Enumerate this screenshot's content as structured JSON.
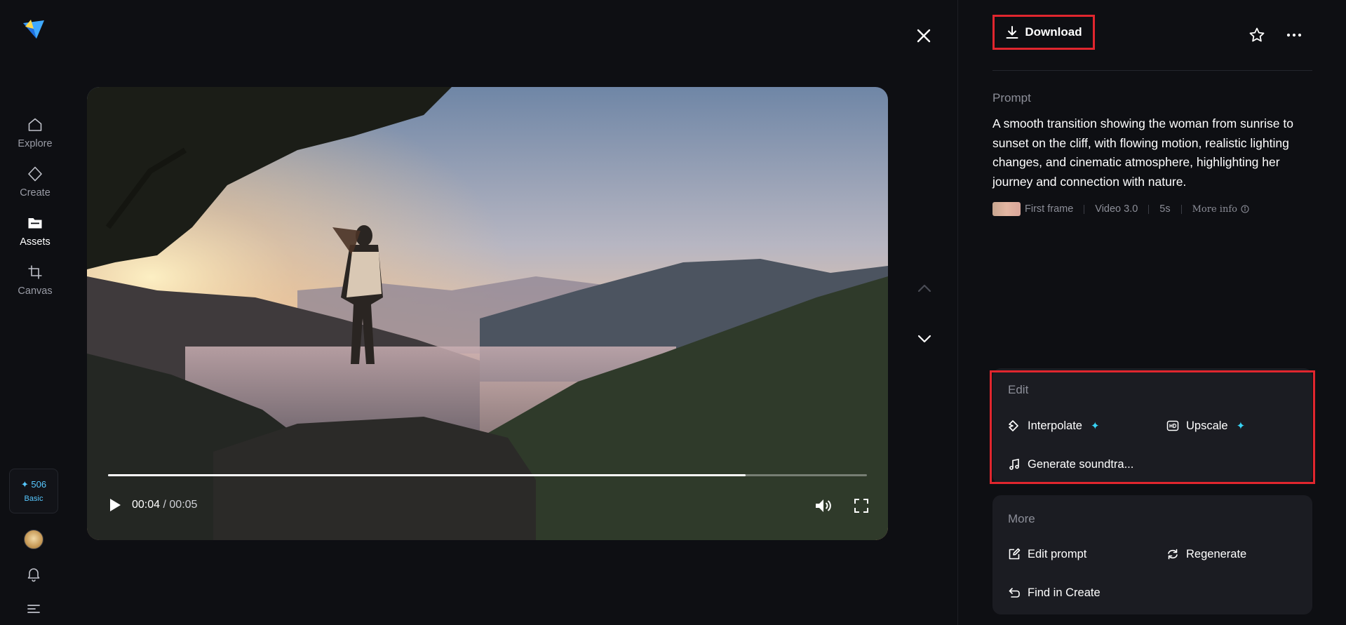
{
  "sidebar": {
    "items": [
      {
        "label": "Explore",
        "icon": "home-icon"
      },
      {
        "label": "Create",
        "icon": "diamond-icon"
      },
      {
        "label": "Assets",
        "icon": "folder-icon"
      },
      {
        "label": "Canvas",
        "icon": "crop-icon"
      }
    ],
    "active": "Assets",
    "credits": {
      "amount": "✦ 506",
      "plan": "Basic"
    }
  },
  "player": {
    "current_time": "00:04",
    "separator": "/",
    "duration": "00:05",
    "progress": 0.84
  },
  "header": {
    "download_label": "Download"
  },
  "prompt": {
    "title": "Prompt",
    "text": "A smooth transition showing the woman from sunrise to sunset on the cliff, with flowing motion, realistic lighting changes, and cinematic atmosphere, highlighting her journey and connection with nature.",
    "meta": {
      "first_frame": "First frame",
      "model": "Video 3.0",
      "duration": "5s",
      "more_info": "More info"
    }
  },
  "edit": {
    "title": "Edit",
    "interpolate": "Interpolate",
    "upscale": "Upscale",
    "soundtrack": "Generate soundtra..."
  },
  "more": {
    "title": "More",
    "edit_prompt": "Edit prompt",
    "regenerate": "Regenerate",
    "find_in_create": "Find in Create"
  },
  "colors": {
    "background": "#0e0f13",
    "card": "#1b1c22",
    "highlight_border": "#e0262e",
    "accent": "#38d3f5"
  }
}
